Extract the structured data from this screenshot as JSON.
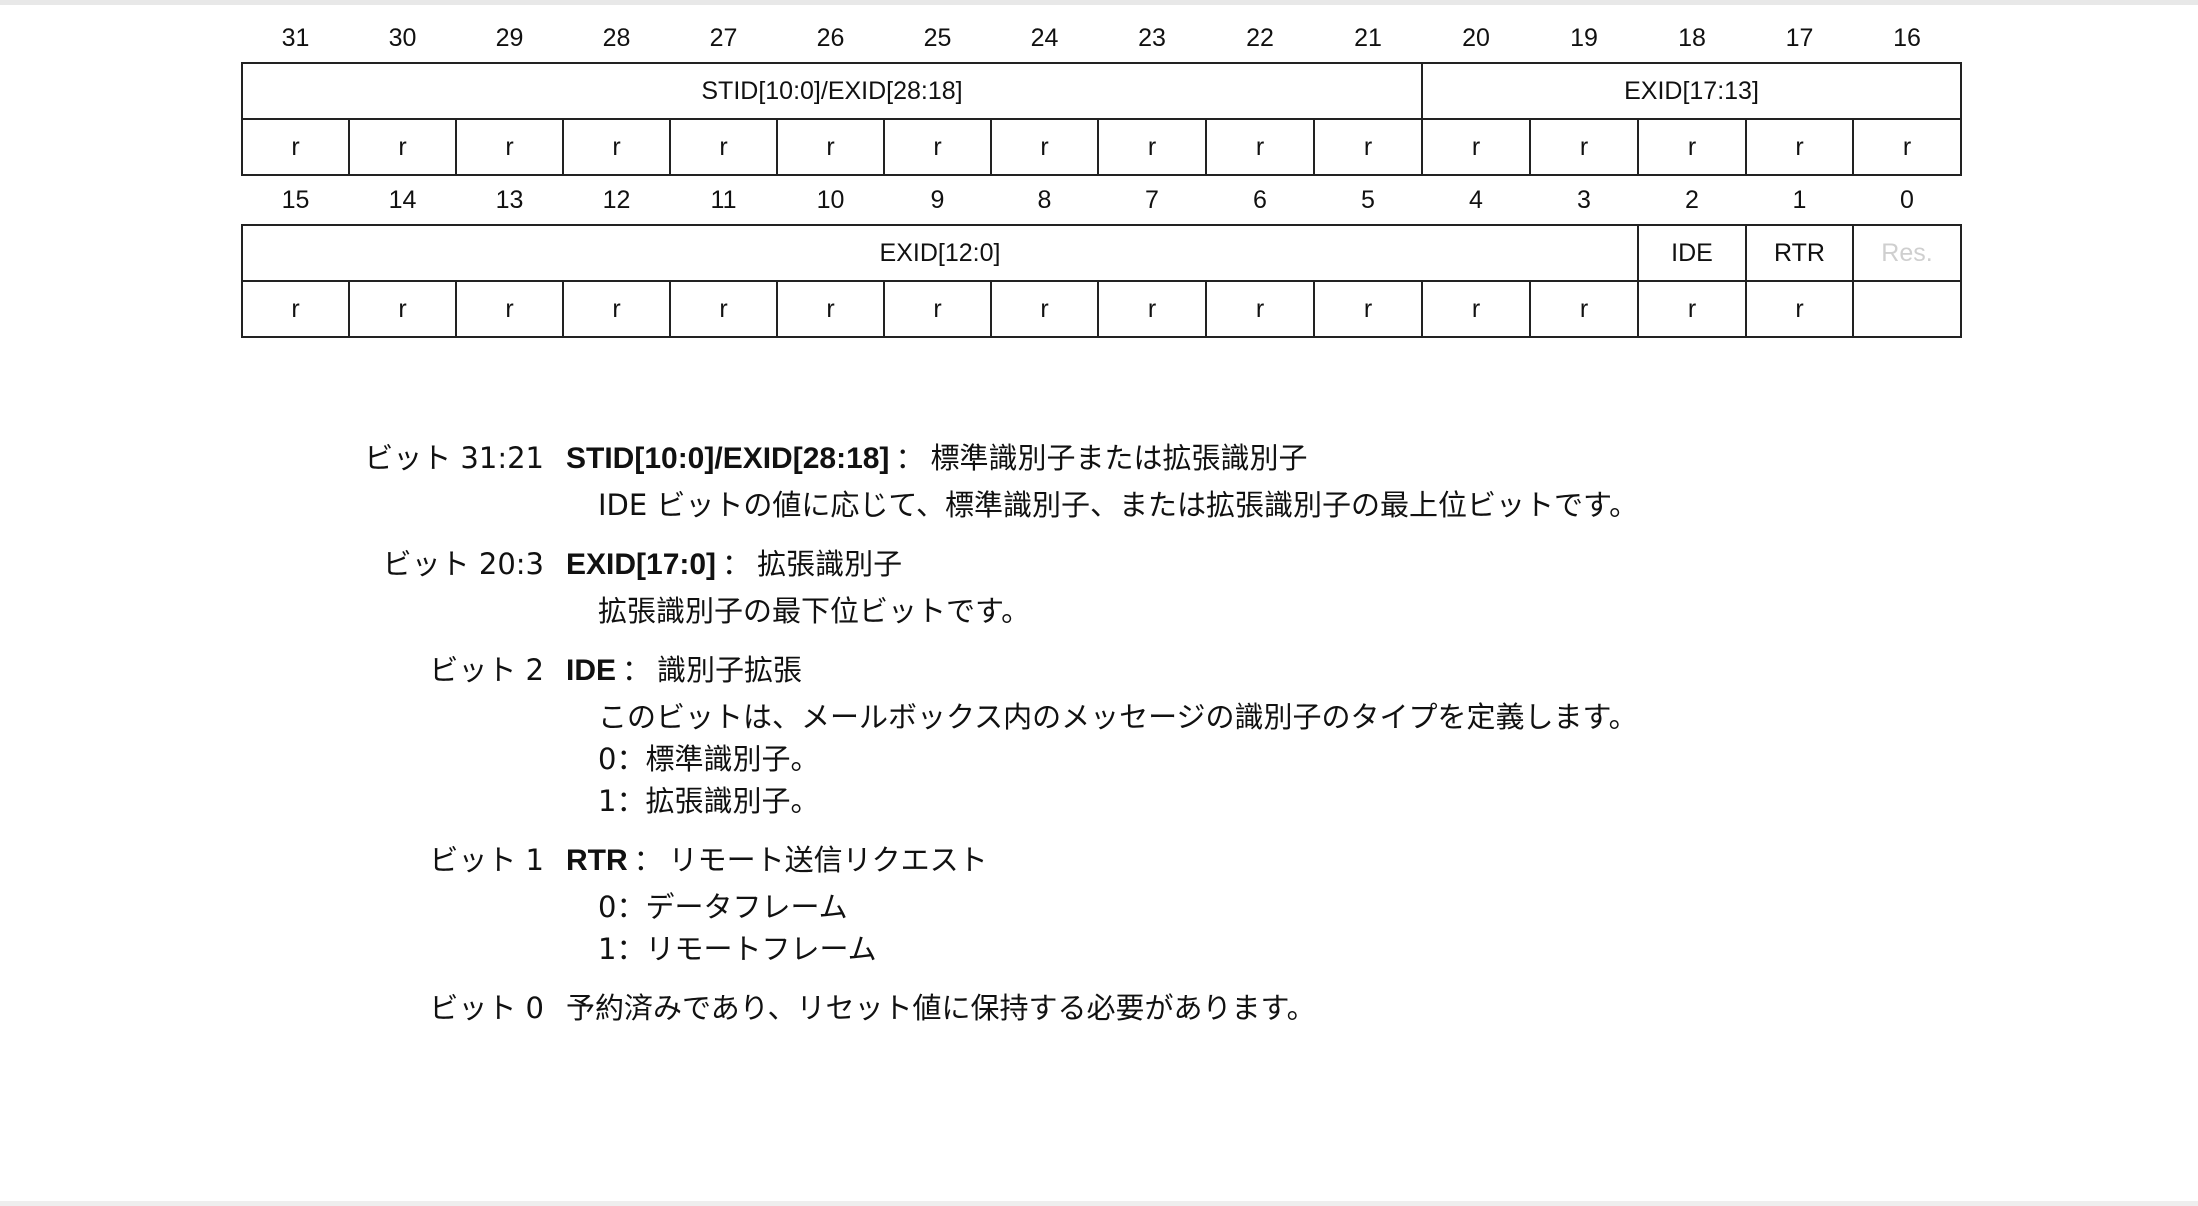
{
  "register": {
    "bits_upper": [
      "31",
      "30",
      "29",
      "28",
      "27",
      "26",
      "25",
      "24",
      "23",
      "22",
      "21",
      "20",
      "19",
      "18",
      "17",
      "16"
    ],
    "fields_upper": [
      {
        "name": "STID[10:0]/EXID[28:18]"
      },
      {
        "name": "EXID[17:13]"
      }
    ],
    "access_upper": [
      "r",
      "r",
      "r",
      "r",
      "r",
      "r",
      "r",
      "r",
      "r",
      "r",
      "r",
      "r",
      "r",
      "r",
      "r",
      "r"
    ],
    "bits_lower": [
      "15",
      "14",
      "13",
      "12",
      "11",
      "10",
      "9",
      "8",
      "7",
      "6",
      "5",
      "4",
      "3",
      "2",
      "1",
      "0"
    ],
    "fields_lower": [
      {
        "name": "EXID[12:0]"
      },
      {
        "name": "IDE"
      },
      {
        "name": "RTR"
      },
      {
        "name": "Res."
      }
    ],
    "access_lower": [
      "r",
      "r",
      "r",
      "r",
      "r",
      "r",
      "r",
      "r",
      "r",
      "r",
      "r",
      "r",
      "r",
      "r",
      "r",
      ""
    ]
  },
  "descriptions": [
    {
      "label": "ビット 31:21",
      "field": "STID[10:0]/EXID[28:18]",
      "separator": "：",
      "title": "標準識別子または拡張識別子",
      "lines": [
        "IDE ビットの値に応じて、標準識別子、または拡張識別子の最上位ビットです。"
      ]
    },
    {
      "label": "ビット 20:3",
      "field": "EXID[17:0]",
      "separator": "：",
      "title": "拡張識別子",
      "lines": [
        "拡張識別子の最下位ビットです。"
      ]
    },
    {
      "label": "ビット 2",
      "field": "IDE",
      "separator": "：",
      "title": "識別子拡張",
      "lines": [
        "このビットは、メールボックス内のメッセージの識別子のタイプを定義します。",
        "0：標準識別子。",
        "1：拡張識別子。"
      ]
    },
    {
      "label": "ビット 1",
      "field": "RTR",
      "separator": "：",
      "title": "リモート送信リクエスト",
      "lines": [
        "0：データフレーム",
        "1：リモートフレーム"
      ]
    },
    {
      "label": "ビット 0",
      "field": "",
      "separator": "",
      "title": "予約済みであり、リセット値に保持する必要があります。",
      "lines": []
    }
  ]
}
